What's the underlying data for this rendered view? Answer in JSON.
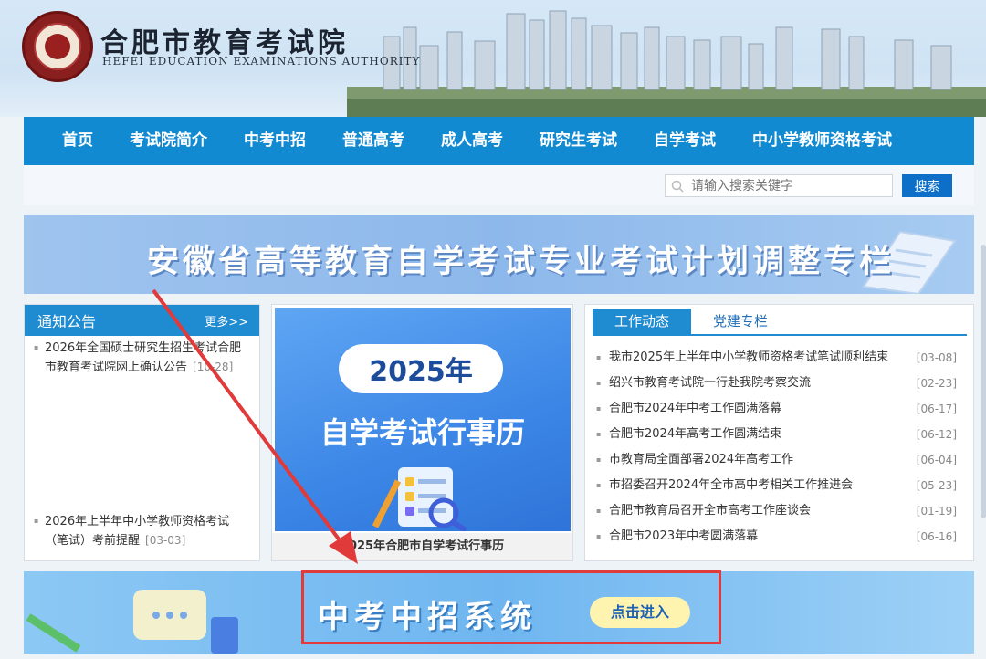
{
  "site": {
    "title_cn": "合肥市教育考试院",
    "title_en": "HEFEI EDUCATION EXAMINATIONS AUTHORITY"
  },
  "nav": {
    "items": [
      {
        "label": "首页"
      },
      {
        "label": "考试院简介"
      },
      {
        "label": "中考中招"
      },
      {
        "label": "普通高考"
      },
      {
        "label": "成人高考"
      },
      {
        "label": "研究生考试"
      },
      {
        "label": "自学考试"
      },
      {
        "label": "中小学教师资格考试"
      }
    ]
  },
  "search": {
    "placeholder": "请输入搜索关键字",
    "button": "搜索"
  },
  "banner_top": {
    "text": "安徽省高等教育自学考试专业考试计划调整专栏"
  },
  "notice": {
    "title": "通知公告",
    "more": "更多>>",
    "items": [
      {
        "text": "2026年全国硕士研究生招生考试合肥市教育考试院网上确认公告",
        "date": "[10-28]"
      },
      {
        "text": "2026年上半年中小学教师资格考试（笔试）考前提醒",
        "date": "[03-03]"
      }
    ]
  },
  "card": {
    "year": "2025年",
    "big_text": "自学考试行事历",
    "caption": "2025年合肥市自学考试行事历"
  },
  "news": {
    "tabs": [
      {
        "label": "工作动态"
      },
      {
        "label": "党建专栏"
      }
    ],
    "items": [
      {
        "text": "我市2025年上半年中小学教师资格考试笔试顺利结束",
        "date": "[03-08]"
      },
      {
        "text": "绍兴市教育考试院一行赴我院考察交流",
        "date": "[02-23]"
      },
      {
        "text": "合肥市2024年中考工作圆满落幕",
        "date": "[06-17]"
      },
      {
        "text": "合肥市2024年高考工作圆满结束",
        "date": "[06-12]"
      },
      {
        "text": "市教育局全面部署2024年高考工作",
        "date": "[06-04]"
      },
      {
        "text": "市招委召开2024年全市高中考相关工作推进会",
        "date": "[05-23]"
      },
      {
        "text": "合肥市教育局召开全市高考工作座谈会",
        "date": "[01-19]"
      },
      {
        "text": "合肥市2023年中考圆满落幕",
        "date": "[06-16]"
      }
    ]
  },
  "banner_bottom": {
    "text": "中考中招系统",
    "enter": "点击进入"
  },
  "colors": {
    "nav_blue": "#118ad2",
    "highlight_red": "#e03a3a"
  }
}
